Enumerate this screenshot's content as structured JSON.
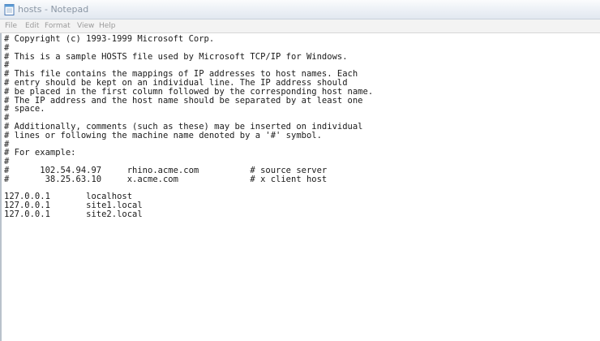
{
  "window": {
    "title": "hosts - Notepad",
    "icon": "notepad-icon"
  },
  "menu": {
    "file": "File",
    "edit": "Edit",
    "format": "Format",
    "view": "View",
    "help": "Help"
  },
  "document": {
    "content": "# Copyright (c) 1993-1999 Microsoft Corp.\n#\n# This is a sample HOSTS file used by Microsoft TCP/IP for Windows.\n#\n# This file contains the mappings of IP addresses to host names. Each\n# entry should be kept on an individual line. The IP address should\n# be placed in the first column followed by the corresponding host name.\n# The IP address and the host name should be separated by at least one\n# space.\n#\n# Additionally, comments (such as these) may be inserted on individual\n# lines or following the machine name denoted by a '#' symbol.\n#\n# For example:\n#\n#      102.54.94.97     rhino.acme.com          # source server\n#       38.25.63.10     x.acme.com              # x client host\n\n127.0.0.1       localhost\n127.0.0.1       site1.local\n127.0.0.1       site2.local"
  }
}
